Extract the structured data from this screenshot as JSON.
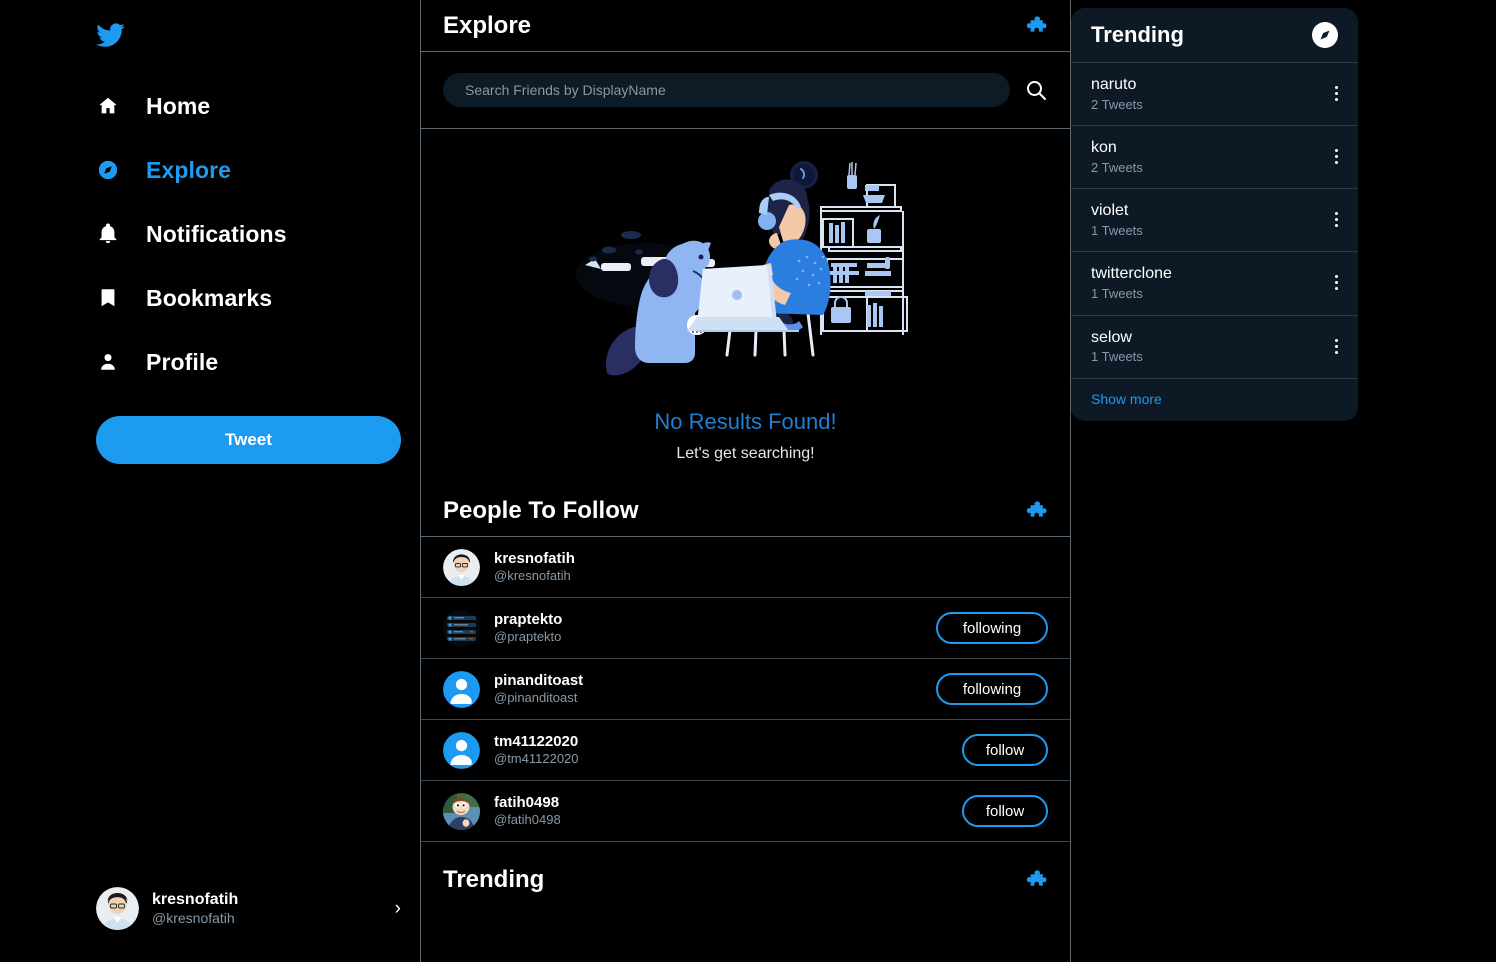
{
  "sidebar": {
    "logo_icon": "twitter-bird-icon",
    "items": [
      {
        "label": "Home",
        "icon": "home-icon",
        "active": false
      },
      {
        "label": "Explore",
        "icon": "compass-icon",
        "active": true
      },
      {
        "label": "Notifications",
        "icon": "bell-icon",
        "active": false
      },
      {
        "label": "Bookmarks",
        "icon": "bookmark-icon",
        "active": false
      },
      {
        "label": "Profile",
        "icon": "person-icon",
        "active": false
      }
    ],
    "tweet_button": "Tweet",
    "profile": {
      "name": "kresnofatih",
      "handle": "@kresnofatih",
      "chevron": "›"
    }
  },
  "main": {
    "explore_header": {
      "title": "Explore",
      "icon": "puzzle-piece-icon"
    },
    "search": {
      "placeholder": "Search Friends by DisplayName",
      "value": "",
      "icon": "search-icon"
    },
    "empty_state": {
      "illustration": "person-with-laptop-and-dog-illustration",
      "title": "No Results Found!",
      "subtitle": "Let's get searching!"
    },
    "people_header": {
      "title": "People To Follow",
      "icon": "puzzle-piece-icon"
    },
    "people": [
      {
        "name": "kresnofatih",
        "handle": "@kresnofatih",
        "action": "",
        "avatar": "photo-avatar"
      },
      {
        "name": "praptekto",
        "handle": "@praptekto",
        "action": "following",
        "avatar": "screenshot-avatar"
      },
      {
        "name": "pinanditoast",
        "handle": "@pinanditoast",
        "action": "following",
        "avatar": "default-avatar"
      },
      {
        "name": "tm41122020",
        "handle": "@tm41122020",
        "action": "follow",
        "avatar": "default-avatar"
      },
      {
        "name": "fatih0498",
        "handle": "@fatih0498",
        "action": "follow",
        "avatar": "cartoon-avatar"
      }
    ],
    "trending_header": {
      "title": "Trending",
      "icon": "puzzle-piece-icon"
    }
  },
  "trending_panel": {
    "title": "Trending",
    "icon": "compass-icon",
    "items": [
      {
        "topic": "naruto",
        "count": "2 Tweets",
        "menu": "more-options-icon"
      },
      {
        "topic": "kon",
        "count": "2 Tweets",
        "menu": "more-options-icon"
      },
      {
        "topic": "violet",
        "count": "1 Tweets",
        "menu": "more-options-icon"
      },
      {
        "topic": "twitterclone",
        "count": "1 Tweets",
        "menu": "more-options-icon"
      },
      {
        "topic": "selow",
        "count": "1 Tweets",
        "menu": "more-options-icon"
      }
    ],
    "show_more": "Show more"
  },
  "colors": {
    "accent": "#1d9bf0",
    "background": "#000000",
    "panel": "#0d1a26",
    "muted_text": "#8899a6",
    "border": "#5a6670"
  }
}
